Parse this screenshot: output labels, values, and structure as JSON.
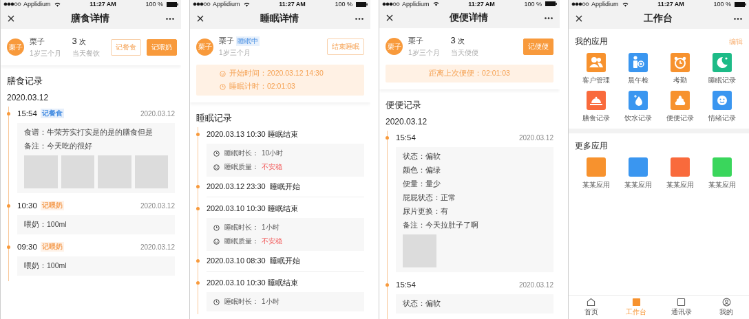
{
  "screens": [
    {
      "kind": "diet",
      "status_bar": {
        "carrier": "Applidium",
        "time": "11:27 AM",
        "battery": "100 %"
      },
      "title": "膳食详情",
      "profile": {
        "avatar": "栗子",
        "name": "栗子",
        "age": "1岁三个月",
        "count": "3",
        "count_unit": "次",
        "count_label": "当天餐饮"
      },
      "actions": [
        {
          "label": "记餐食",
          "kind": "outline"
        },
        {
          "label": "记喂奶",
          "kind": "filled"
        }
      ],
      "section_title": "膳食记录",
      "date": "2020.03.12",
      "entries": [
        {
          "time": "15:54",
          "tag": "记餐食",
          "color": "#4a90e2",
          "date": "2020.03.12",
          "lines": [
            "食谱：牛荣芳实打实是的是的膳食但是",
            "备注：今天吃的很好"
          ],
          "images": [
            {
              "kind": "placeholder"
            },
            {
              "kind": "placeholder"
            },
            {
              "kind": "placeholder"
            },
            {
              "kind": "placeholder"
            }
          ]
        },
        {
          "time": "10:30",
          "tag": "记喂奶",
          "color": "#f5a25a",
          "date": "2020.03.12",
          "lines": [
            "喂奶：100ml"
          ]
        },
        {
          "time": "09:30",
          "tag": "记喂奶",
          "color": "#f5a25a",
          "date": "2020.03.12",
          "lines": [
            "喂奶：100ml"
          ]
        }
      ]
    },
    {
      "kind": "sleep",
      "status_bar": {
        "carrier": "Applidium",
        "time": "11:27 AM",
        "battery": "100 %"
      },
      "title": "睡眠详情",
      "profile": {
        "avatar": "栗子",
        "name": "栗子",
        "status_tag": "睡眠中",
        "age": "1岁三个月"
      },
      "actions": [
        {
          "label": "结束睡眠",
          "kind": "outline"
        }
      ],
      "banner": {
        "kind": "icons",
        "lines": [
          "开始时间：2020.03.12 14:30",
          "睡眠计时：02:01:03"
        ]
      },
      "section_title": "睡眠记录",
      "records": [
        {
          "kind": "end",
          "title": "2020.03.13 10:30 睡眠结束",
          "details": [
            {
              "label": "睡眠时长：",
              "value": "10小时",
              "alert": false
            },
            {
              "label": "睡眠质量：",
              "value": "不安稳",
              "alert": true
            }
          ]
        },
        {
          "kind": "start",
          "title": "2020.03.12 23:30  睡眠开始"
        },
        {
          "kind": "end",
          "title": "2020.03.10 10:30 睡眠结束",
          "details": [
            {
              "label": "睡眠时长：",
              "value": "1小时",
              "alert": false
            },
            {
              "label": "睡眠质量：",
              "value": "不安稳",
              "alert": true
            }
          ]
        },
        {
          "kind": "start",
          "title": "2020.03.10 08:30  睡眠开始"
        },
        {
          "kind": "end",
          "title": "2020.03.10 10:30 睡眠结束",
          "details": [
            {
              "label": "睡眠时长：",
              "value": "1小时",
              "alert": false
            }
          ]
        }
      ]
    },
    {
      "kind": "poop",
      "status_bar": {
        "carrier": "Applidium",
        "time": "11:27 AM",
        "battery": "100 %"
      },
      "title": "便便详情",
      "profile": {
        "avatar": "栗子",
        "name": "栗子",
        "age": "1岁三个月",
        "count": "3",
        "count_unit": "次",
        "count_label": "当天便便"
      },
      "actions": [
        {
          "label": "记便便",
          "kind": "filled"
        }
      ],
      "banner": {
        "kind": "plain",
        "lines": [
          "距离上次便便：02:01:03"
        ]
      },
      "section_title": "便便记录",
      "date": "2020.03.12",
      "entries": [
        {
          "time": "15:54",
          "date": "2020.03.12",
          "lines": [
            "状态：偏软",
            "颜色：偏绿",
            "便量：量少",
            "屁屁状态：正常",
            "尿片更换：有",
            "备注：今天拉肚子了啊"
          ],
          "images": [
            {
              "kind": "placeholder"
            }
          ]
        },
        {
          "time": "15:54",
          "date": "2020.03.12",
          "lines": [
            "状态：偏软"
          ]
        }
      ]
    },
    {
      "kind": "workbench",
      "status_bar": {
        "carrier": "Applidium",
        "time": "11:27 AM",
        "battery": "100 %"
      },
      "title": "工作台",
      "sections": [
        {
          "title": "我的应用",
          "action": "编辑",
          "apps": [
            {
              "label": "客户管理",
              "color": "#f7922e"
            },
            {
              "label": "晨午检",
              "color": "#3a96f0"
            },
            {
              "label": "考勤",
              "color": "#f7922e"
            },
            {
              "label": "睡眠记录",
              "color": "#1dbb87"
            },
            {
              "label": "膳食记录",
              "color": "#f96a3c"
            },
            {
              "label": "饮水记录",
              "color": "#3a96f0"
            },
            {
              "label": "便便记录",
              "color": "#f7922e"
            },
            {
              "label": "情绪记录",
              "color": "#3a96f0"
            }
          ]
        },
        {
          "title": "更多应用",
          "apps": [
            {
              "label": "某某应用",
              "color": "#f7922e"
            },
            {
              "label": "某某应用",
              "color": "#3a96f0"
            },
            {
              "label": "某某应用",
              "color": "#f96a3c"
            },
            {
              "label": "某某应用",
              "color": "#3ad65c"
            }
          ]
        }
      ],
      "tab_bar": [
        {
          "label": "首页",
          "selected": false
        },
        {
          "label": "工作台",
          "selected": true
        },
        {
          "label": "通讯录",
          "selected": false
        },
        {
          "label": "我的",
          "selected": false
        }
      ]
    }
  ]
}
